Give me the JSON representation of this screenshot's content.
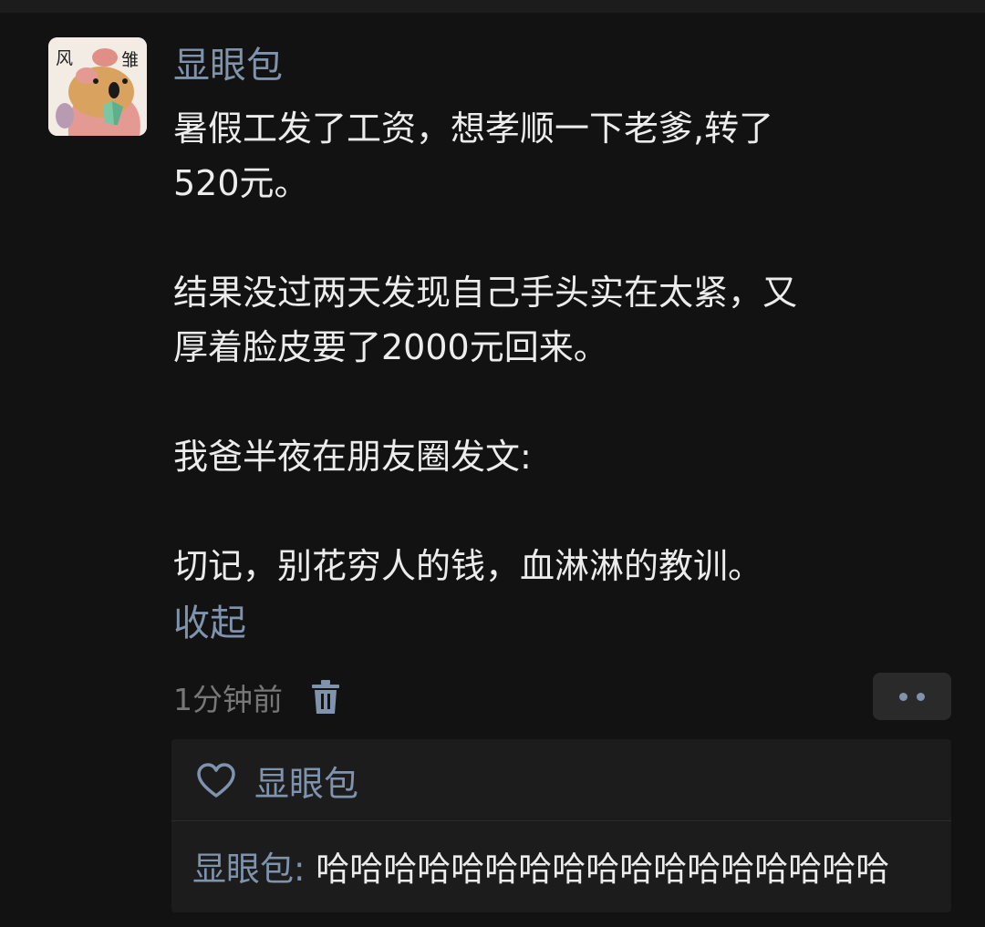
{
  "post": {
    "author": "显眼包",
    "avatar_text_left": "风",
    "avatar_text_right": "雏",
    "paragraphs": [
      [
        "暑假工发了工资，想孝顺一下老爹,转了",
        "520元。"
      ],
      [
        "结果没过两天发现自己手头实在太紧，又",
        "厚着脸皮要了2000元回来。"
      ],
      [
        "我爸半夜在朋友圈发文:"
      ],
      [
        "切记，别花穷人的钱，血淋淋的教训。"
      ]
    ],
    "collapse_label": "收起",
    "timestamp": "1分钟前"
  },
  "likes": {
    "names": "显眼包"
  },
  "comments": [
    {
      "author": "显眼包",
      "separator": ": ",
      "text": "哈哈哈哈哈哈哈哈哈哈哈哈哈哈哈哈哈"
    }
  ],
  "icons": {
    "delete": "trash-icon",
    "more": "more-dots-icon",
    "like": "heart-outline-icon"
  },
  "colors": {
    "background": "#121212",
    "link": "#7f93ac",
    "text": "#ececec",
    "muted": "#777777",
    "panel": "#1c1c1d"
  }
}
